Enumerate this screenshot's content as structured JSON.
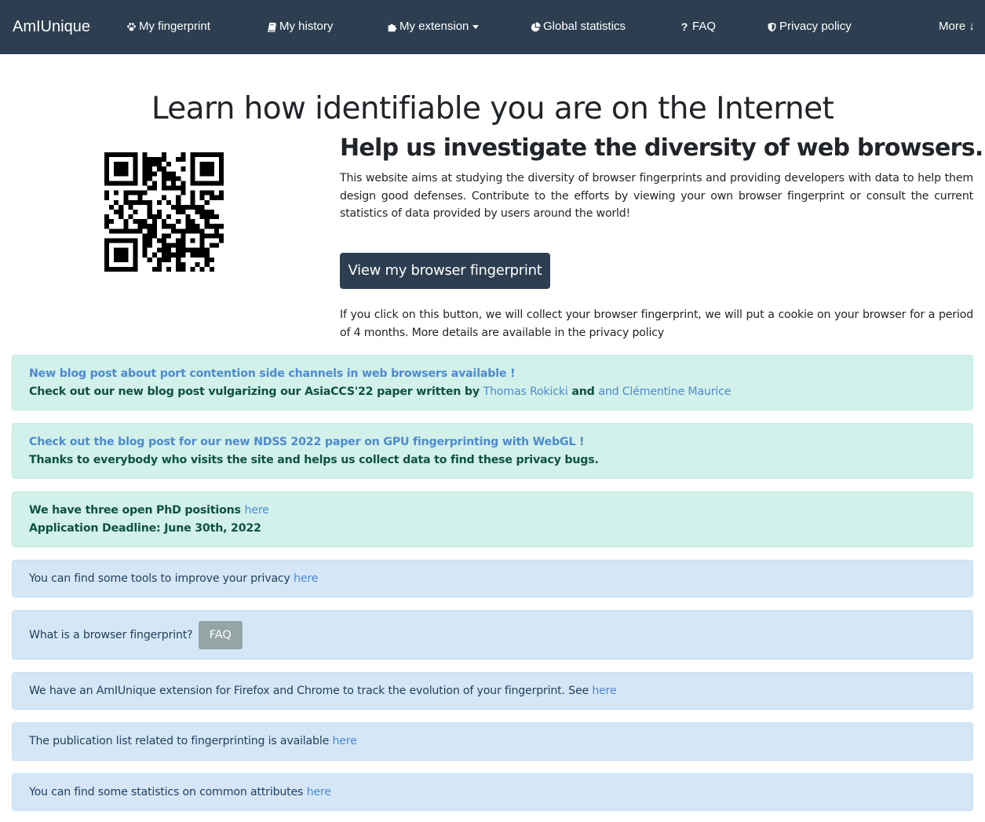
{
  "navbar": {
    "brand": "AmIUnique",
    "items": [
      {
        "label": "My fingerprint",
        "icon": "paw-icon"
      },
      {
        "label": "My history",
        "icon": "book-icon"
      },
      {
        "label": "My extension",
        "icon": "puzzle-icon"
      },
      {
        "label": "Global statistics",
        "icon": "pie-chart-icon"
      },
      {
        "label": "FAQ",
        "icon": "question-icon"
      },
      {
        "label": "Privacy policy",
        "icon": "shield-icon"
      }
    ],
    "more_label": "More ↓"
  },
  "hero": {
    "title": "Learn how identifiable you are on the Internet",
    "subtitle": "Help us investigate the diversity of web browsers.",
    "intro": "This website aims at studying the diversity of browser fingerprints and providing developers with data to help them design good defenses. Contribute to the efforts by viewing your own browser fingerprint or consult the current statistics of data provided by users around the world!",
    "button_label": "View my browser fingerprint",
    "notice": "If you click on this button, we will collect your browser fingerprint, we will put a cookie on your browser for a period of 4 months. More details are available in the privacy policy"
  },
  "alerts": {
    "blog_port": {
      "link": "New blog post about port contention side channels in web browsers available !",
      "text": "Check out our new blog post vulgarizing our AsiaCCS'22 paper written by ",
      "author1": "Thomas Rokicki",
      "and": " and ",
      "author2": "and Clémentine Maurice"
    },
    "blog_gpu": {
      "link": "Check out the blog post for our new NDSS 2022 paper on GPU fingerprinting with WebGL !",
      "text": "Thanks to everybody who visits the site and helps us collect data to find these privacy bugs."
    },
    "phd": {
      "text": "We have three open PhD positions ",
      "link": "here",
      "deadline": "Application Deadline: June 30th, 2022"
    },
    "tools": {
      "text": "You can find some tools to improve your privacy ",
      "link": "here"
    },
    "what_is": {
      "text": "What is a browser fingerprint? ",
      "button": "FAQ"
    },
    "extension": {
      "text": "We have an AmIUnique extension for Firefox and Chrome to track the evolution of your fingerprint. See ",
      "link": "here"
    },
    "publications": {
      "text": "The publication list related to fingerprinting is available ",
      "link": "here"
    },
    "statistics": {
      "text": "You can find some statistics on common attributes ",
      "link": "here"
    }
  },
  "colors": {
    "navbar_bg": "#2c3e50",
    "success_bg": "#d2f1ea",
    "success_text": "#0e5142",
    "info_bg": "#d5e7f7",
    "info_text": "#1f3f5d",
    "link": "#4d8ad1",
    "faq_button_bg": "#95a5a6"
  }
}
